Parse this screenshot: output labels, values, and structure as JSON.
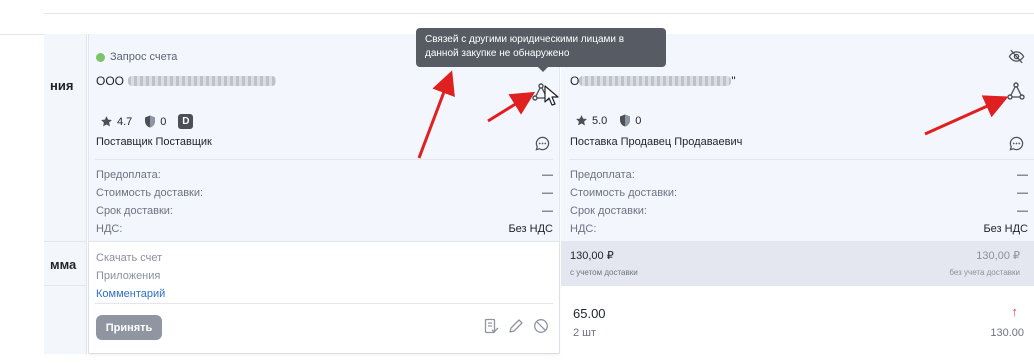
{
  "rows": {
    "label_1": "ния",
    "label_2": "мма"
  },
  "tooltip": {
    "text": "Связей с другими юридическими лицами в данной закупке не обнаружено"
  },
  "offer_1": {
    "status": "Запрос счета",
    "status_color": "#7cc467",
    "company_prefix": "ООО",
    "rating": "4.7",
    "reviews": "0",
    "badge": "D",
    "supplier": "Поставщик Поставщик",
    "info": [
      {
        "label": "Предоплата:",
        "value": "—"
      },
      {
        "label": "Стоимость доставки:",
        "value": "—"
      },
      {
        "label": "Срок доставки:",
        "value": "—"
      },
      {
        "label": "НДС:",
        "value": "Без НДС"
      }
    ],
    "links": {
      "download": "Скачать счет",
      "attachments": "Приложения",
      "comment": "Комментарий"
    },
    "accept_label": "Принять"
  },
  "offer_2": {
    "company_prefix": "О",
    "company_suffix": "\"",
    "rating": "5.0",
    "reviews": "0",
    "supplier": "Поставка Продавец Продаваевич",
    "info": [
      {
        "label": "Предоплата:",
        "value": "—"
      },
      {
        "label": "Стоимость доставки:",
        "value": "—"
      },
      {
        "label": "Срок доставки:",
        "value": "—"
      },
      {
        "label": "НДС:",
        "value": "Без НДС"
      }
    ],
    "sum": {
      "with_delivery": "130,00 ₽",
      "with_delivery_note": "с учетом доставки",
      "without_delivery": "130,00 ₽",
      "without_delivery_note": "без учета доставки"
    },
    "qty": {
      "price": "65.00",
      "units": "2 шт",
      "arrow": "↑",
      "total": "130.00"
    }
  },
  "colors": {
    "accent_link": "#2f6fc9",
    "annotation_red": "#e02020",
    "price_up_red": "#e03b3b"
  }
}
